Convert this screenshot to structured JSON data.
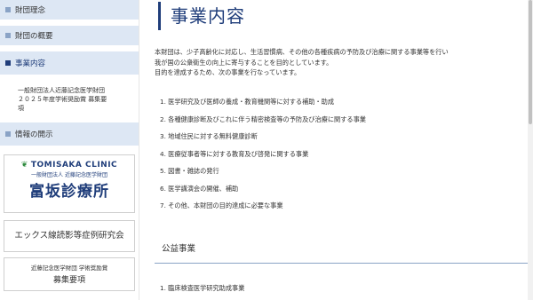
{
  "sidebar": {
    "items": [
      {
        "label": "財団理念"
      },
      {
        "label": "財団の概要"
      },
      {
        "label": "事業内容"
      },
      {
        "label": "情報の開示"
      }
    ],
    "sub_item": {
      "line1": "一般財団法人近藤記念医学財団",
      "line2": "２０２５年度学術奨励賞 募集要",
      "line3": "項"
    }
  },
  "banners": {
    "clinic": {
      "en": "TOMISAKA CLINIC",
      "sub": "一般財団法人 近藤記念医学財団",
      "ja": "富坂診療所"
    },
    "xray": {
      "label": "エックス線読影等症例研究会"
    },
    "award": {
      "line1": "近藤記念医学財団 学術奨励賞",
      "line2": "募集要項"
    }
  },
  "main": {
    "title": "事業内容",
    "intro": [
      "本財団は、少子高齢化に対応し、生活習慣病、その他の各種疾病の予防及び治療に関する事業等を行い",
      "我が国の公衆衛生の向上に寄与することを目的としています。",
      "目的を達成するため、次の事業を行なっています。"
    ],
    "projects": [
      "1. 医学研究及び医師の養成・教育機関等に対する補助・助成",
      "2. 各種健康診断及びこれに伴う精密検査等の予防及び治療に関する事業",
      "3. 地域住民に対する無料健康診断",
      "4. 医療従事者等に対する教育及び啓発に関する事業",
      "5. 図書・雑誌の発行",
      "6. 医学講演会の開催、補助",
      "7. その他、本財団の目的達成に必要な事業"
    ],
    "public_section": {
      "title": "公益事業",
      "items": [
        "1. 臨床検査医学研究助成事業"
      ]
    }
  },
  "colors": {
    "accent": "#1f3d7a",
    "nav_bg": "#dde7f4",
    "green": "#2e8b3e"
  }
}
